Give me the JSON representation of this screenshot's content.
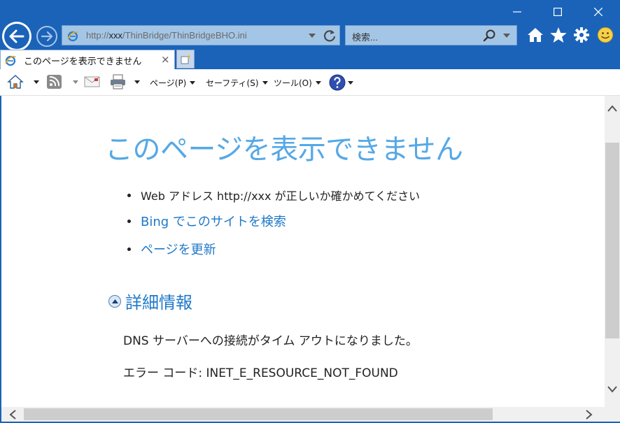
{
  "window": {
    "caption_buttons": [
      "minimize",
      "maximize",
      "close"
    ]
  },
  "nav": {
    "address_parts": {
      "prefix": "http://",
      "host": "xxx",
      "path": "/ThinBridge/ThinBridgeBHO.ini"
    },
    "search_placeholder": "検索..."
  },
  "tab": {
    "title": "このページを表示できません",
    "close": "×"
  },
  "commandbar": {
    "page": "ページ(P)",
    "safety": "セーフティ(S)",
    "tools": "ツール(O)"
  },
  "content": {
    "title": "このページを表示できません",
    "bullets": [
      "Web アドレス http://xxx が正しいか確かめてください",
      "Bing でこのサイトを検索",
      "ページを更新"
    ],
    "details_label": "詳細情報",
    "detail_lines": [
      "DNS サーバーへの接続がタイム アウトになりました。",
      "エラー コード: INET_E_RESOURCE_NOT_FOUND"
    ]
  },
  "colors": {
    "frame": "#1a63b8",
    "title": "#55a8e6",
    "link": "#1f78c8"
  }
}
